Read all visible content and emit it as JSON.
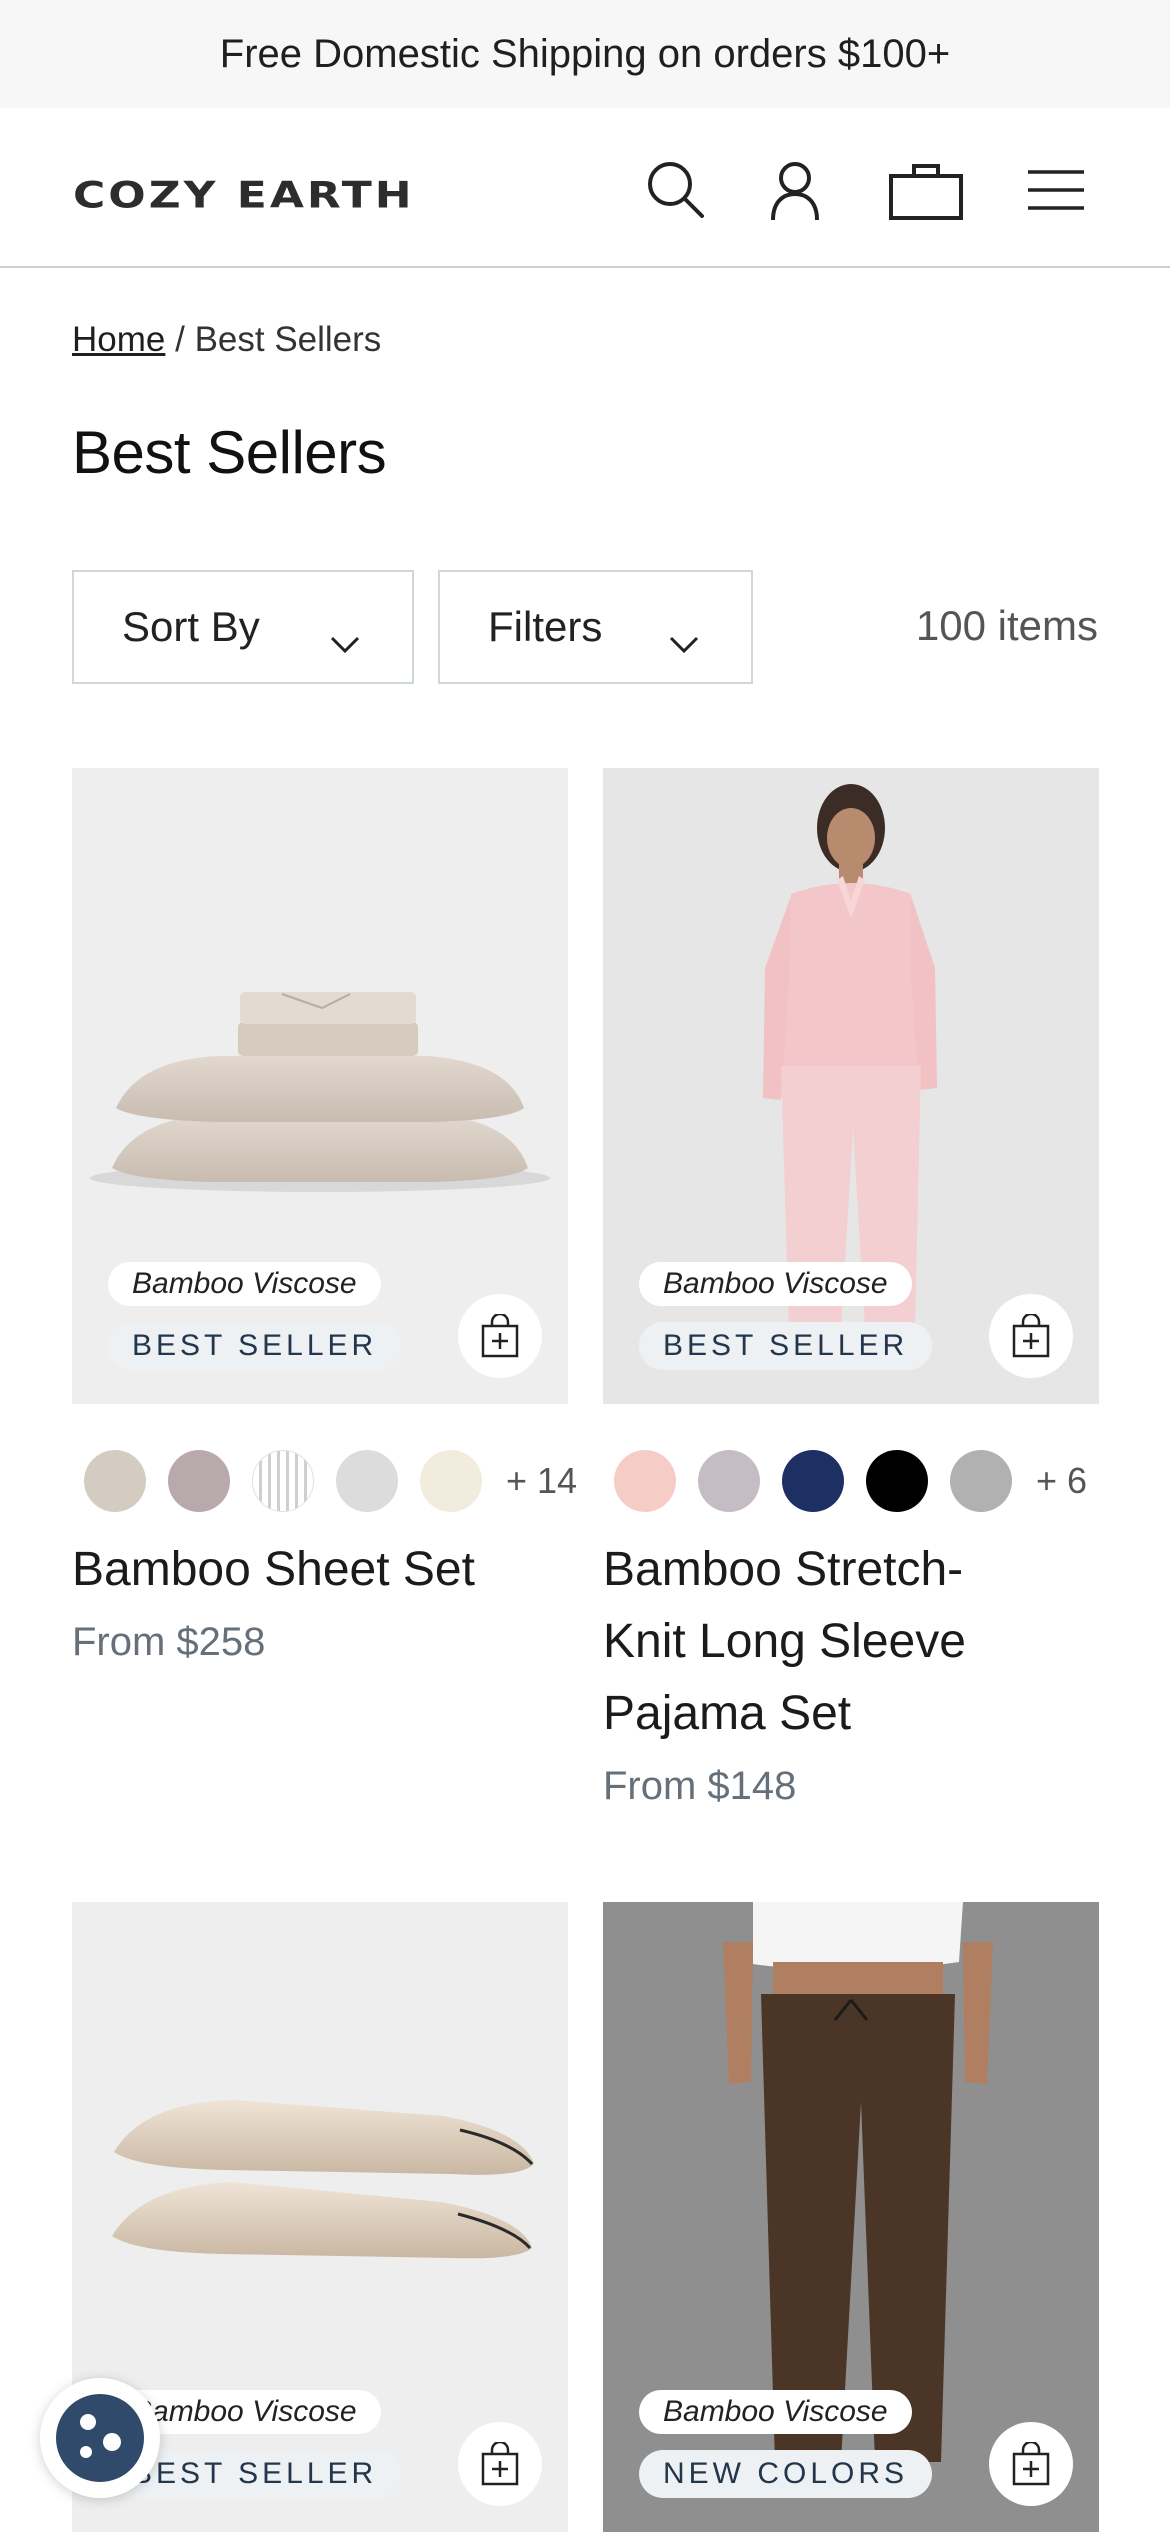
{
  "promo": {
    "text": "Free Domestic Shipping on orders $100+"
  },
  "header": {
    "logo": "COZY EARTH",
    "icons": [
      "search-icon",
      "account-icon",
      "cart-icon",
      "menu-icon"
    ]
  },
  "breadcrumb": {
    "home": "Home",
    "separator": " / ",
    "current": "Best Sellers"
  },
  "page_title": "Best Sellers",
  "controls": {
    "sort_label": "Sort By",
    "filter_label": "Filters",
    "item_count": "100 items"
  },
  "colors": {
    "badge_text": "#22364c",
    "price": "#66707a",
    "cookie": "#2f4a6b"
  },
  "products": [
    {
      "tag": "Bamboo Viscose",
      "badge": "BEST SELLER",
      "name": "Bamboo Sheet Set",
      "price": "From $258",
      "swatches": [
        "#d5ccc1",
        "#b8a9ad",
        "striped",
        "#dcdcdc",
        "#f2ecdf"
      ],
      "more_colors": "+ 14"
    },
    {
      "tag": "Bamboo Viscose",
      "badge": "BEST SELLER",
      "name": "Bamboo Stretch-Knit Long Sleeve Pajama Set",
      "price": "From $148",
      "swatches": [
        "#f6cdc6",
        "#c6bcc4",
        "#1d2f63",
        "#000000",
        "#b1b1b1"
      ],
      "more_colors": "+ 6"
    },
    {
      "tag": "Bamboo Viscose",
      "badge": "BEST SELLER"
    },
    {
      "tag": "Bamboo Viscose",
      "badge": "NEW COLORS"
    }
  ]
}
